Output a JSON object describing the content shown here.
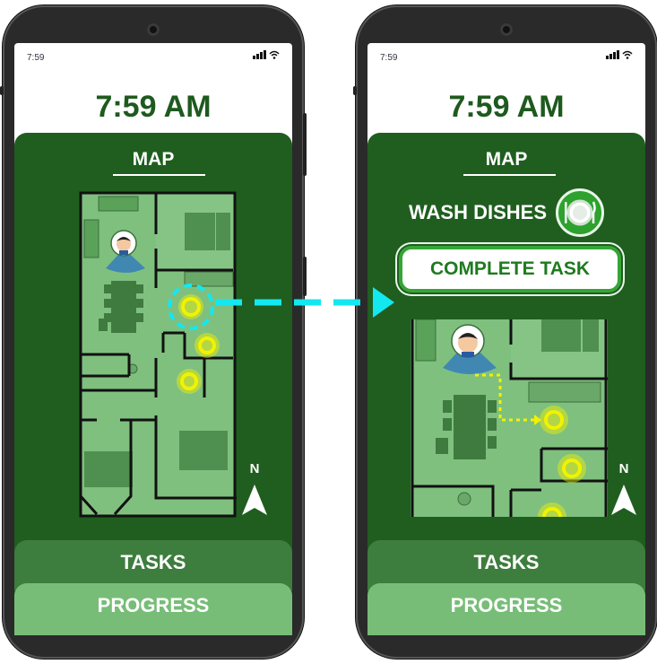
{
  "left_phone": {
    "status_time": "7:59",
    "clock": "7:59 AM",
    "map_title": "MAP",
    "compass_label": "N",
    "tabs": {
      "tasks": "TASKS",
      "progress": "PROGRESS"
    }
  },
  "right_phone": {
    "status_time": "7:59",
    "clock": "7:59 AM",
    "map_title": "MAP",
    "task_name": "WASH DISHES",
    "complete_button": "COMPLETE TASK",
    "compass_label": "N",
    "tabs": {
      "tasks": "TASKS",
      "progress": "PROGRESS"
    }
  },
  "colors": {
    "panel": "#1f5e1f",
    "floor": "#7fc07f",
    "wall": "#111111",
    "marker": "#f2f200",
    "transition_arrow": "#13e8f0",
    "tab_tasks": "#3d7d3d",
    "tab_progress": "#77bd77"
  },
  "icons": [
    "camera-icon",
    "signal-icon",
    "wifi-icon",
    "user-avatar-icon",
    "task-marker-icon",
    "plate-icon",
    "compass-arrow-icon",
    "transition-arrow-icon"
  ]
}
